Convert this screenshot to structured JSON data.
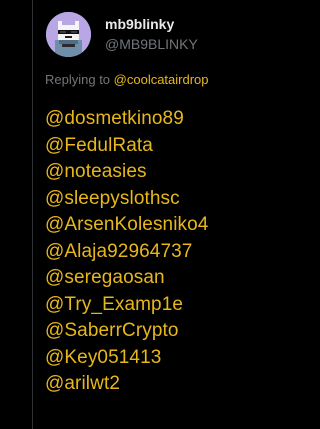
{
  "tweet": {
    "display_name": "mb9blinky",
    "handle": "@MB9BLINKY",
    "reply_prefix": "Replying to ",
    "reply_target": "@coolcatairdrop",
    "mentions": [
      "@dosmetkino89",
      "@FedulRata",
      "@noteasies",
      "@sleepyslothsc",
      "@ArsenKolesniko4",
      "@Alaja92964737",
      "@seregaosan",
      "@Try_Examp1e",
      "@SaberrCrypto",
      "@Key051413",
      "@arilwt2"
    ]
  },
  "colors": {
    "background": "#000000",
    "primary_text": "#e7e9ea",
    "secondary_text": "#71767b",
    "link_accent": "#e8b71c",
    "avatar_background": "#b9a6e4"
  },
  "icons": {
    "avatar": "pixel-cat-avatar-icon"
  }
}
